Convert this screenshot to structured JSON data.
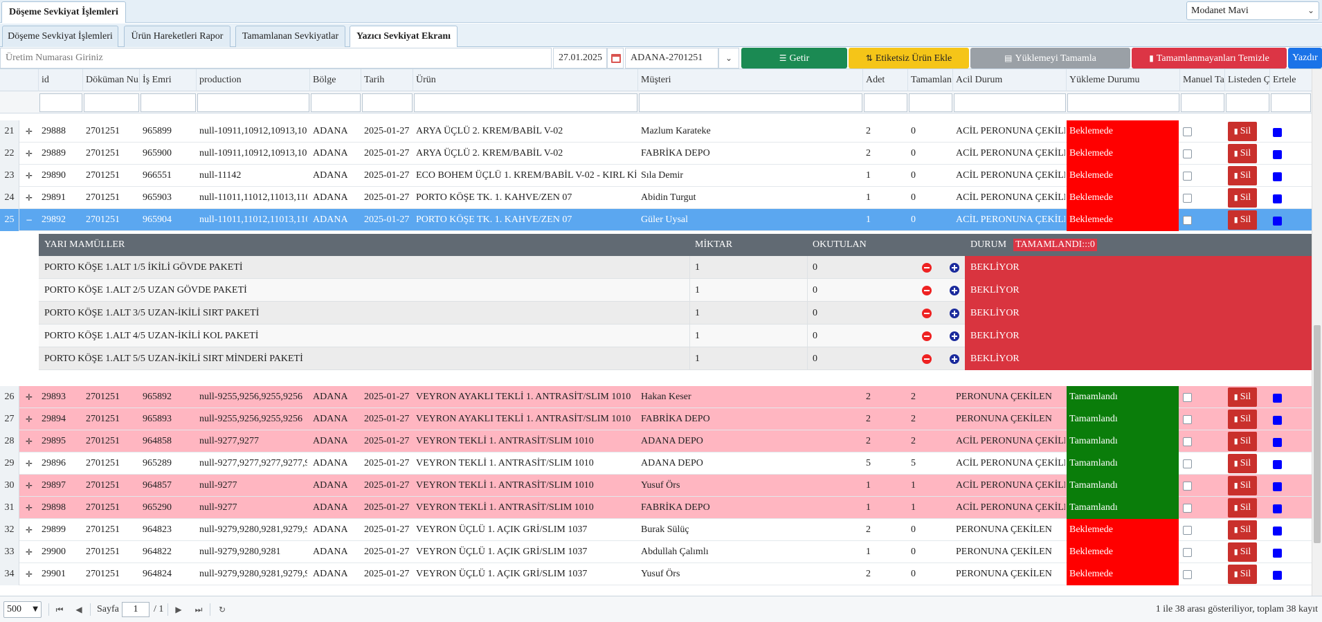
{
  "app": {
    "tab_label": "Döşeme Sevkiyat İşlemleri",
    "theme": "Modanet Mavi"
  },
  "tabs": [
    {
      "label": "Döşeme Sevkiyat İşlemleri",
      "active": false
    },
    {
      "label": "Ürün Hareketleri Rapor",
      "active": false
    },
    {
      "label": "Tamamlanan Sevkiyatlar",
      "active": false
    },
    {
      "label": "Yazıcı Sevkiyat Ekranı",
      "active": true
    }
  ],
  "toolbar": {
    "production_placeholder": "Üretim Numarası Giriniz",
    "date_value": "27.01.2025",
    "document_value": "ADANA-2701251",
    "buttons": {
      "getir": {
        "label": "Getir",
        "icon": "list-icon",
        "color": "#1b8a53"
      },
      "etiketsiz": {
        "label": "Etiketsiz Ürün Ekle",
        "icon": "transfer-icon",
        "color": "#f5c518"
      },
      "yukleme": {
        "label": "Yüklemeyi Tamamla",
        "icon": "clipboard-icon",
        "color": "#9aa0a6"
      },
      "temizle": {
        "label": "Tamamlanmayanları Temizle",
        "icon": "trash-icon",
        "color": "#dc3545"
      },
      "yazdir": {
        "label": "Yazdır",
        "icon": "print-icon",
        "color": "#1a73e8"
      }
    }
  },
  "grid": {
    "columns": [
      "id",
      "Döküman Nu",
      "İş Emri",
      "production",
      "Bölge",
      "Tarih",
      "Ürün",
      "Müşteri",
      "Adet",
      "Tamamlan",
      "Acil Durum",
      "Yükleme Durumu",
      "Manuel Ta",
      "Listeden Ç",
      "Ertele"
    ],
    "delete_label": "Sil",
    "rows_before": [
      {
        "num": "21",
        "id": "29888",
        "doc": "2701251",
        "order": "965899",
        "production": "null-10911,10912,10913,109",
        "region": "ADANA",
        "date": "2025-01-27",
        "product": "ARYA ÜÇLÜ 2. KREM/BABİL V-02",
        "customer": "Mazlum Karateke",
        "qty": "2",
        "completed": "0",
        "urgent": "ACİL PERONUNA ÇEKİLE",
        "status": "Beklemede",
        "state": "waiting",
        "tint": "white"
      },
      {
        "num": "22",
        "id": "29889",
        "doc": "2701251",
        "order": "965900",
        "production": "null-10911,10912,10913,109",
        "region": "ADANA",
        "date": "2025-01-27",
        "product": "ARYA ÜÇLÜ 2. KREM/BABİL V-02",
        "customer": "FABRİKA DEPO",
        "qty": "2",
        "completed": "0",
        "urgent": "ACİL PERONUNA ÇEKİLE",
        "status": "Beklemede",
        "state": "waiting",
        "tint": "white"
      },
      {
        "num": "23",
        "id": "29890",
        "doc": "2701251",
        "order": "966551",
        "production": "null-11142",
        "region": "ADANA",
        "date": "2025-01-27",
        "product": "ECO BOHEM ÜÇLÜ 1. KREM/BABİL V-02 - KIRL Kİ",
        "customer": "Sıla Demir",
        "qty": "1",
        "completed": "0",
        "urgent": "ACİL PERONUNA ÇEKİLE",
        "status": "Beklemede",
        "state": "waiting",
        "tint": "white"
      },
      {
        "num": "24",
        "id": "29891",
        "doc": "2701251",
        "order": "965903",
        "production": "null-11011,11012,11013,110",
        "region": "ADANA",
        "date": "2025-01-27",
        "product": "PORTO KÖŞE TK. 1. KAHVE/ZEN 07",
        "customer": "Abidin Turgut",
        "qty": "1",
        "completed": "0",
        "urgent": "ACİL PERONUNA ÇEKİLE",
        "status": "Beklemede",
        "state": "waiting",
        "tint": "white"
      },
      {
        "num": "25",
        "id": "29892",
        "doc": "2701251",
        "order": "965904",
        "production": "null-11011,11012,11013,110",
        "region": "ADANA",
        "date": "2025-01-27",
        "product": "PORTO KÖŞE TK. 1. KAHVE/ZEN 07",
        "customer": "Güler Uysal",
        "qty": "1",
        "completed": "0",
        "urgent": "ACİL PERONUNA ÇEKİLE",
        "status": "Beklemede",
        "state": "waiting",
        "tint": "selected",
        "expanded": true
      }
    ],
    "rows_after": [
      {
        "num": "26",
        "id": "29893",
        "doc": "2701251",
        "order": "965892",
        "production": "null-9255,9256,9255,9256",
        "region": "ADANA",
        "date": "2025-01-27",
        "product": "VEYRON AYAKLI TEKLİ 1. ANTRASİT/SLIM 1010",
        "customer": "Hakan Keser",
        "qty": "2",
        "completed": "2",
        "urgent": "PERONUNA ÇEKİLEN",
        "status": "Tamamlandı",
        "state": "done",
        "tint": "pink"
      },
      {
        "num": "27",
        "id": "29894",
        "doc": "2701251",
        "order": "965893",
        "production": "null-9255,9256,9255,9256",
        "region": "ADANA",
        "date": "2025-01-27",
        "product": "VEYRON AYAKLI TEKLİ 1. ANTRASİT/SLIM 1010",
        "customer": "FABRİKA DEPO",
        "qty": "2",
        "completed": "2",
        "urgent": "PERONUNA ÇEKİLEN",
        "status": "Tamamlandı",
        "state": "done",
        "tint": "pink"
      },
      {
        "num": "28",
        "id": "29895",
        "doc": "2701251",
        "order": "964858",
        "production": "null-9277,9277",
        "region": "ADANA",
        "date": "2025-01-27",
        "product": "VEYRON TEKLİ 1. ANTRASİT/SLIM 1010",
        "customer": "ADANA DEPO",
        "qty": "2",
        "completed": "2",
        "urgent": "ACİL PERONUNA ÇEKİLE",
        "status": "Tamamlandı",
        "state": "done",
        "tint": "pink"
      },
      {
        "num": "29",
        "id": "29896",
        "doc": "2701251",
        "order": "965289",
        "production": "null-9277,9277,9277,9277,9",
        "region": "ADANA",
        "date": "2025-01-27",
        "product": "VEYRON TEKLİ 1. ANTRASİT/SLIM 1010",
        "customer": "ADANA DEPO",
        "qty": "5",
        "completed": "5",
        "urgent": "ACİL PERONUNA ÇEKİLE",
        "status": "Tamamlandı",
        "state": "done",
        "tint": "white"
      },
      {
        "num": "30",
        "id": "29897",
        "doc": "2701251",
        "order": "964857",
        "production": "null-9277",
        "region": "ADANA",
        "date": "2025-01-27",
        "product": "VEYRON TEKLİ 1. ANTRASİT/SLIM 1010",
        "customer": "Yusuf Örs",
        "qty": "1",
        "completed": "1",
        "urgent": "ACİL PERONUNA ÇEKİLE",
        "status": "Tamamlandı",
        "state": "done",
        "tint": "pink"
      },
      {
        "num": "31",
        "id": "29898",
        "doc": "2701251",
        "order": "965290",
        "production": "null-9277",
        "region": "ADANA",
        "date": "2025-01-27",
        "product": "VEYRON TEKLİ 1. ANTRASİT/SLIM 1010",
        "customer": "FABRİKA DEPO",
        "qty": "1",
        "completed": "1",
        "urgent": "ACİL PERONUNA ÇEKİLE",
        "status": "Tamamlandı",
        "state": "done",
        "tint": "pink"
      },
      {
        "num": "32",
        "id": "29899",
        "doc": "2701251",
        "order": "964823",
        "production": "null-9279,9280,9281,9279,9",
        "region": "ADANA",
        "date": "2025-01-27",
        "product": "VEYRON ÜÇLÜ 1. AÇIK GRİ/SLIM 1037",
        "customer": "Burak Sülüç",
        "qty": "2",
        "completed": "0",
        "urgent": "PERONUNA ÇEKİLEN",
        "status": "Beklemede",
        "state": "waiting",
        "tint": "white"
      },
      {
        "num": "33",
        "id": "29900",
        "doc": "2701251",
        "order": "964822",
        "production": "null-9279,9280,9281",
        "region": "ADANA",
        "date": "2025-01-27",
        "product": "VEYRON ÜÇLÜ 1. AÇIK GRİ/SLIM 1037",
        "customer": "Abdullah Çalımlı",
        "qty": "1",
        "completed": "0",
        "urgent": "PERONUNA ÇEKİLEN",
        "status": "Beklemede",
        "state": "waiting",
        "tint": "white"
      },
      {
        "num": "34",
        "id": "29901",
        "doc": "2701251",
        "order": "964824",
        "production": "null-9279,9280,9281,9279,9",
        "region": "ADANA",
        "date": "2025-01-27",
        "product": "VEYRON ÜÇLÜ 1. AÇIK GRİ/SLIM 1037",
        "customer": "Yusuf Örs",
        "qty": "2",
        "completed": "0",
        "urgent": "PERONUNA ÇEKİLEN",
        "status": "Beklemede",
        "state": "waiting",
        "tint": "white"
      }
    ]
  },
  "detail": {
    "headers": {
      "item": "YARI MAMÜLLER",
      "qty": "MİKTAR",
      "read": "OKUTULAN",
      "status": "DURUM",
      "done_badge": "TAMAMLANDI:::0"
    },
    "rows": [
      {
        "item": "PORTO KÖŞE 1.ALT 1/5 İKİLİ GÖVDE PAKETİ",
        "qty": "1",
        "read": "0",
        "status": "BEKLİYOR"
      },
      {
        "item": "PORTO KÖŞE 1.ALT 2/5 UZAN GÖVDE PAKETİ",
        "qty": "1",
        "read": "0",
        "status": "BEKLİYOR"
      },
      {
        "item": "PORTO KÖŞE 1.ALT 3/5 UZAN-İKİLİ SIRT PAKETİ",
        "qty": "1",
        "read": "0",
        "status": "BEKLİYOR"
      },
      {
        "item": "PORTO KÖŞE 1.ALT 4/5 UZAN-İKİLİ KOL PAKETİ",
        "qty": "1",
        "read": "0",
        "status": "BEKLİYOR"
      },
      {
        "item": "PORTO KÖŞE 1.ALT 5/5 UZAN-İKİLİ SIRT MİNDERİ PAKETİ",
        "qty": "1",
        "read": "0",
        "status": "BEKLİYOR"
      }
    ]
  },
  "pager": {
    "page_size": "500",
    "page_label": "Sayfa",
    "page": "1",
    "total_pages": "/ 1",
    "summary": "1 ile 38 arası gösteriliyor, toplam 38 kayıt"
  }
}
